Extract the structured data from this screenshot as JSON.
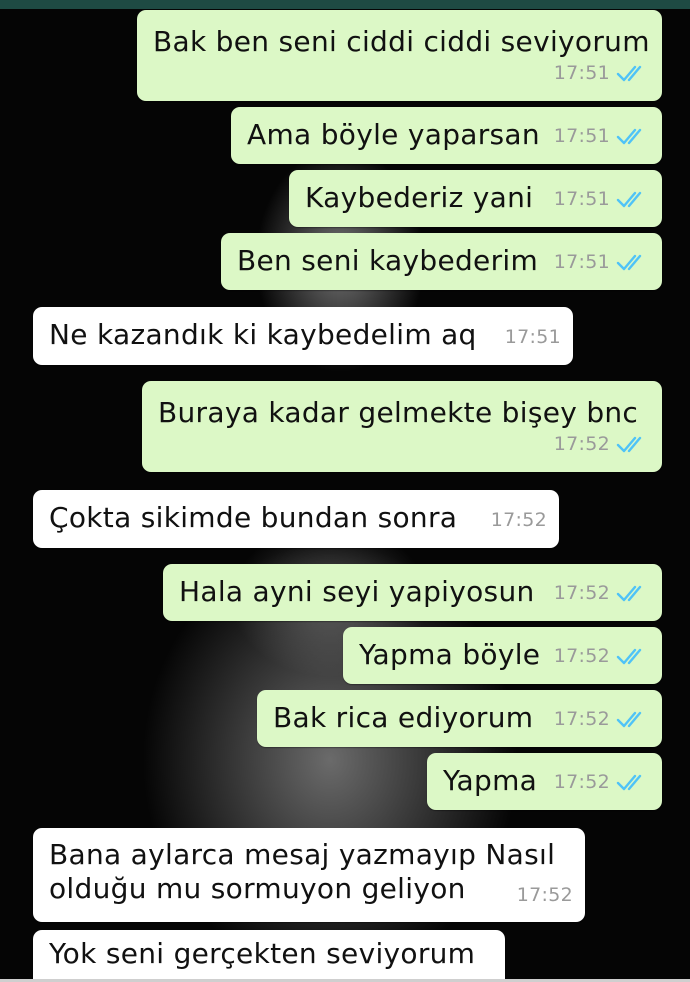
{
  "messages": [
    {
      "text": "Bak ben seni ciddi ciddi seviyorum",
      "time": "17:51",
      "dir": "out",
      "read": true
    },
    {
      "text": "Ama böyle yaparsan",
      "time": "17:51",
      "dir": "out",
      "read": true
    },
    {
      "text": "Kaybederiz yani",
      "time": "17:51",
      "dir": "out",
      "read": true
    },
    {
      "text": "Ben seni kaybederim",
      "time": "17:51",
      "dir": "out",
      "read": true
    },
    {
      "text": "Ne kazandık ki kaybedelim aq",
      "time": "17:51",
      "dir": "in"
    },
    {
      "text": "Buraya kadar gelmekte bişey bnc",
      "time": "17:52",
      "dir": "out",
      "read": true
    },
    {
      "text": "Çokta sikimde bundan sonra",
      "time": "17:52",
      "dir": "in"
    },
    {
      "text": "Hala ayni seyi yapiyosun",
      "time": "17:52",
      "dir": "out",
      "read": true
    },
    {
      "text": "Yapma böyle",
      "time": "17:52",
      "dir": "out",
      "read": true
    },
    {
      "text": "Bak rica ediyorum",
      "time": "17:52",
      "dir": "out",
      "read": true
    },
    {
      "text": "Yapma",
      "time": "17:52",
      "dir": "out",
      "read": true
    },
    {
      "text_line1": "Bana aylarca mesaj yazmayıp Nasıl",
      "text_line2": "olduğu mu sormuyon geliyon",
      "time": "17:52",
      "dir": "in"
    },
    {
      "text": "Yok seni gerçekten seviyorum",
      "dir": "in"
    }
  ],
  "colors": {
    "outgoing_bubble": "#dcf8c6",
    "incoming_bubble": "#ffffff",
    "read_ticks": "#4fc3f7",
    "status_bar": "#1e4a43"
  },
  "icons": {
    "read_receipt": "double-check-icon"
  }
}
